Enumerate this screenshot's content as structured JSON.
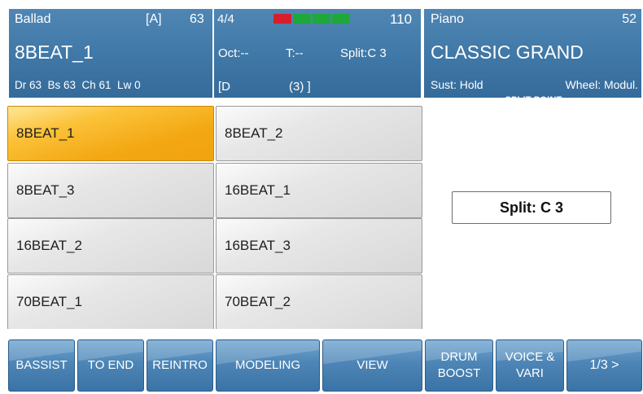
{
  "style_panel": {
    "category": "Ballad",
    "variation": "[A]",
    "style_number": "63",
    "style_name": "8BEAT_1",
    "tracks": "Dr 63  Bs 63  Ch 61  Lw 0"
  },
  "mid_panel": {
    "time_signature": "4/4",
    "tempo": "110",
    "octave": "Oct:--",
    "transpose": "T:--",
    "split": "Split:C 3",
    "chord": "[D",
    "chord_detail": "(3) ]",
    "beat_indicator_colors": [
      "#d81e2a",
      "#1fa83a",
      "#1fa83a",
      "#1fa83a"
    ]
  },
  "voice_panel": {
    "category": "Piano",
    "number": "52",
    "voice_name": "CLASSIC GRAND",
    "sustain": "Sust: Hold",
    "wheel": "Wheel: Modul."
  },
  "style_grid": [
    {
      "label": "8BEAT_1",
      "selected": true
    },
    {
      "label": "8BEAT_2",
      "selected": false
    },
    {
      "label": "8BEAT_3",
      "selected": false
    },
    {
      "label": "16BEAT_1",
      "selected": false
    },
    {
      "label": "16BEAT_2",
      "selected": false
    },
    {
      "label": "16BEAT_3",
      "selected": false
    },
    {
      "label": "70BEAT_1",
      "selected": false
    },
    {
      "label": "70BEAT_2",
      "selected": false
    }
  ],
  "split_point": {
    "title": "SPLIT POINT",
    "value": "Split: C 3"
  },
  "buttons": {
    "bassist": "BASSIST",
    "to_end": "TO END",
    "reintro": "REINTRO",
    "modeling": "MODELING",
    "view": "VIEW",
    "drum_boost_line1": "DRUM",
    "drum_boost_line2": "BOOST",
    "voice_vari_line1": "VOICE &",
    "voice_vari_line2": "VARI",
    "page": "1/3 >"
  },
  "colors": {
    "panel_blue": "#3f77a6",
    "selected_orange": "#f3a712",
    "button_blue": "#4d85b6"
  }
}
